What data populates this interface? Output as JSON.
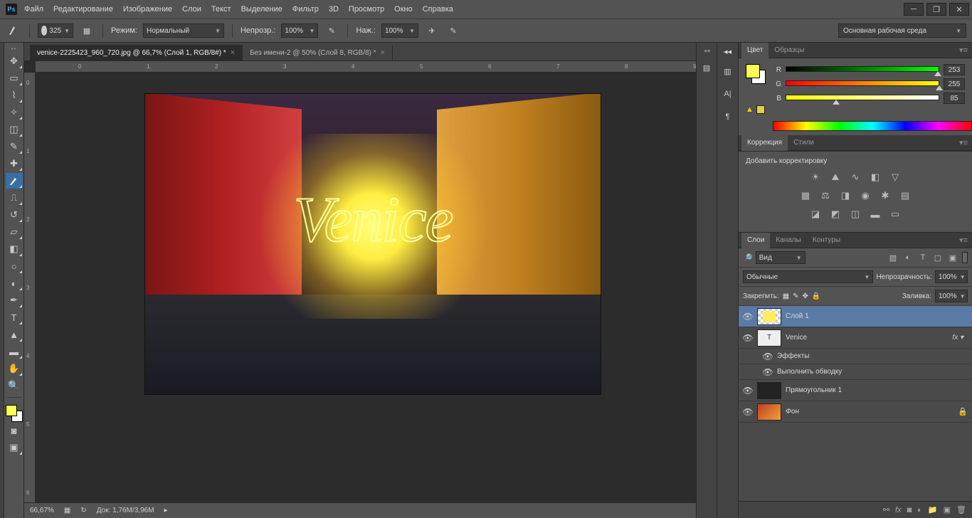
{
  "menu": {
    "items": [
      "Файл",
      "Редактирование",
      "Изображение",
      "Слои",
      "Текст",
      "Выделение",
      "Фильтр",
      "3D",
      "Просмотр",
      "Окно",
      "Справка"
    ]
  },
  "options_bar": {
    "brush_size": "325",
    "mode_label": "Режим:",
    "mode_value": "Нормальный",
    "opacity_label": "Непрозр.:",
    "opacity_value": "100%",
    "flow_label": "Наж.:",
    "flow_value": "100%",
    "workspace": "Основная рабочая среда"
  },
  "tabs": {
    "items": [
      {
        "label": "venice-2225423_960_720.jpg @ 66,7% (Слой 1, RGB/8#) *",
        "active": true
      },
      {
        "label": "Без имени-2 @ 50% (Слой 8, RGB/8) *",
        "active": false
      }
    ]
  },
  "canvas_text": "Venice",
  "status": {
    "zoom": "66,67%",
    "doc_label": "Док:",
    "doc_value": "1,76M/3,96M"
  },
  "ruler_h": [
    "0",
    "1",
    "2",
    "3",
    "4",
    "5",
    "6",
    "7",
    "8",
    "9"
  ],
  "ruler_v": [
    "0",
    "1",
    "2",
    "3",
    "4",
    "5",
    "6"
  ],
  "color_panel": {
    "tabs": [
      "Цвет",
      "Образцы"
    ],
    "channels": [
      {
        "label": "R",
        "value": "253",
        "pos": 99,
        "grad": "linear-gradient(to right,#000,#0f0)"
      },
      {
        "label": "G",
        "value": "255",
        "pos": 100,
        "grad": "linear-gradient(to right,#f00,#ff0)"
      },
      {
        "label": "B",
        "value": "85",
        "pos": 33,
        "grad": "linear-gradient(to right,#ff0,#fff)"
      }
    ]
  },
  "adjustments": {
    "tabs": [
      "Коррекция",
      "Стили"
    ],
    "title": "Добавить корректировку"
  },
  "layers_panel": {
    "tabs": [
      "Слои",
      "Каналы",
      "Контуры"
    ],
    "filter_label": "Вид",
    "blend_mode": "Обычные",
    "opacity_label": "Непрозрачность:",
    "opacity_value": "100%",
    "lock_label": "Закрепить:",
    "fill_label": "Заливка:",
    "fill_value": "100%",
    "layers": [
      {
        "name": "Слой 1",
        "selected": true,
        "visible": true,
        "type": "pixel"
      },
      {
        "name": "Venice",
        "selected": false,
        "visible": true,
        "type": "text",
        "fx": true
      },
      {
        "name": "Эффекты",
        "sub": true
      },
      {
        "name": "Выполнить обводку",
        "sub": true
      },
      {
        "name": "Прямоугольник 1",
        "selected": false,
        "visible": true,
        "type": "shape"
      },
      {
        "name": "Фон",
        "selected": false,
        "visible": true,
        "type": "bg",
        "locked": true,
        "italic": true
      }
    ]
  }
}
